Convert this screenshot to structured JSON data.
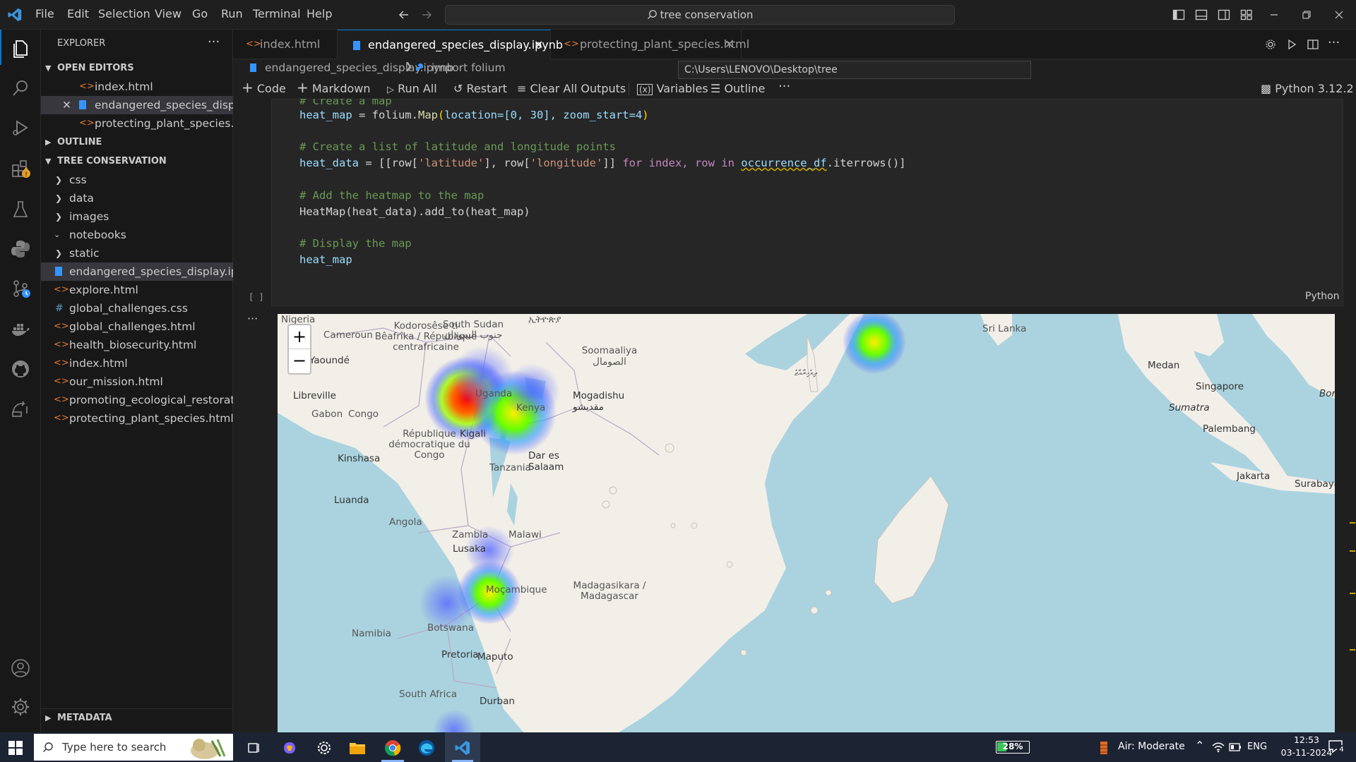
{
  "menu": [
    "File",
    "Edit",
    "Selection",
    "View",
    "Go",
    "Run",
    "Terminal",
    "Help"
  ],
  "search": {
    "text": "tree conservation"
  },
  "sidebar": {
    "title": "EXPLORER",
    "open_editors": "OPEN EDITORS",
    "open_files": [
      "index.html",
      "endangered_species_displ...",
      "protecting_plant_species.h..."
    ],
    "outline": "OUTLINE",
    "folder": "TREE CONSERVATION",
    "tree": [
      "css",
      "data",
      "images",
      "notebooks",
      "static",
      "endangered_species_display.ipy...",
      "explore.html",
      "global_challenges.css",
      "global_challenges.html",
      "health_biosecurity.html",
      "index.html",
      "our_mission.html",
      "promoting_ecological_restorati...",
      "protecting_plant_species.html"
    ],
    "metadata": "METADATA"
  },
  "tabs": [
    "index.html",
    "endangered_species_display.ipynb",
    "protecting_plant_species.html"
  ],
  "breadcrumb": {
    "file": "endangered_species_display.ipynb",
    "symbol": "import folium"
  },
  "tooltip": "C:\\Users\\LENOVO\\Desktop\\tree conservation\\protecting_plant_species.html",
  "toolbar": {
    "code": "Code",
    "markdown": "Markdown",
    "run_all": "Run All",
    "restart": "Restart",
    "clear": "Clear All Outputs",
    "variables": "Variables",
    "outline": "Outline",
    "kernel": "Python 3.12.2"
  },
  "cell": {
    "lang": "Python",
    "exec": "[ ]",
    "top_comment": "# Create a map",
    "line1": {
      "var": "heat_map",
      "rest1": " = folium.",
      "fn": "Map",
      "args": "location=[0, 30], zoom_start=4"
    },
    "comment2": "# Create a list of latitude and longitude points",
    "line2a": "heat_data",
    "line2b": " = [[row[",
    "str_lat": "'latitude'",
    "str_lon": "'longitude'",
    "line2c": "for index, row in",
    "line2d": "occurrence_df",
    "line2e": ".iterrows()]",
    "comment3": "# Add the heatmap to the map",
    "line3a": "HeatMap",
    "line3b": "(heat_data).add_to(heat_map)",
    "comment4": "# Display the map",
    "line4": "heat_map"
  },
  "map": {
    "zoom_in": "+",
    "zoom_out": "−",
    "labels": [
      "Nigeria",
      "Cameroun",
      "Kodorosêse ti Bêafrîka / République centrafricaine",
      "South Sudan جنوب السودان",
      "ኢትዮጵያ",
      "Soomaaliya الصومال",
      "Yaoundé",
      "Libreville",
      "Gabon",
      "Congo",
      "République démocratique du Congo",
      "Kinshasa",
      "Uganda",
      "Kenya",
      "Kigali",
      "Mogadishu مقديشو",
      "Tanzania",
      "Dar es Salaam",
      "Luanda",
      "Angola",
      "Zambia",
      "Lusaka",
      "Malawi",
      "Moçambique",
      "Madagasikara / Madagascar",
      "Namibia",
      "Botswana",
      "Pretoria",
      "Maputo",
      "South Africa",
      "Durban",
      "Sri Lanka",
      "ދިވެހިރާއްޖެ",
      "Medan",
      "Singapore",
      "Sumatra",
      "Palembang",
      "Jakarta",
      "Surabaya",
      "Borneo"
    ]
  },
  "taskbar": {
    "search": "Type here to search",
    "battery": "28%",
    "air": "Air: Moderate",
    "lang": "ENG",
    "time": "12:53",
    "date": "03-11-2024",
    "notif": "4"
  }
}
